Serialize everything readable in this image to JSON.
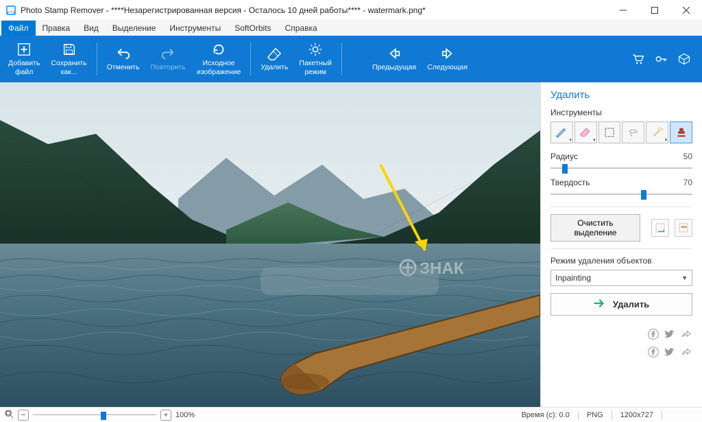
{
  "title": "Photo Stamp Remover - ****Незарегистрированная версия - Осталось 10 дней работы**** - watermark.png*",
  "menus": {
    "file": "Файл",
    "edit": "Правка",
    "view": "Вид",
    "selection": "Выделение",
    "tools": "Инструменты",
    "softorbits": "SoftOrbits",
    "help": "Справка"
  },
  "ribbon": {
    "add_file": "Добавить\nфайл",
    "save_as": "Сохранить\nкак...",
    "undo": "Отменить",
    "redo": "Повторить",
    "reset_image": "Исходное\nизображение",
    "remove": "Удалить",
    "batch_mode": "Пакетный\nрежим",
    "prev": "Предыдущая",
    "next": "Следующая"
  },
  "panel": {
    "heading": "Удалить",
    "tools_label": "Инструменты",
    "radius_label": "Радиус",
    "radius_value": "50",
    "hardness_label": "Твердость",
    "hardness_value": "70",
    "clear_selection": "Очистить выделение",
    "remove_mode_label": "Режим удаления объектов",
    "remove_mode_value": "Inpainting",
    "remove_button": "Удалить"
  },
  "watermark_overlay": "ЗНАК",
  "status": {
    "zoom_pct": "100%",
    "time_label": "Время (с):",
    "time_value": "0.0",
    "format": "PNG",
    "dimensions": "1200x727"
  }
}
